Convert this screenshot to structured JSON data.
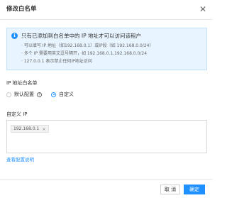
{
  "dialog": {
    "title": "修改白名单",
    "close_icon": "close-icon"
  },
  "notice": {
    "icon": "info-icon",
    "title": "只有已添加到白名单中的 IP 地址才可以访问该租户",
    "lines": [
      "· 可以填写 IP 地址（如192.168.0.1）或IP段（如 192.168.0.0/24）",
      "· 多个 IP 需要用英文逗号隔开，如 192.168.0.1,192.168.0.0/24",
      "· 127.0.0.1 表示禁止任何IP地址访问"
    ]
  },
  "whitelist": {
    "label": "IP 地址白名单",
    "options": [
      {
        "label": "默认配置",
        "selected": false,
        "help_icon": "help-icon"
      },
      {
        "label": "自定义",
        "selected": true
      }
    ]
  },
  "custom_ip": {
    "label": "自定义 IP",
    "tags": [
      "192.168.0.1"
    ],
    "tag_remove": "×"
  },
  "doc_link": "查看配置说明",
  "footer": {
    "cancel_label": "取 消",
    "ok_label": "确定"
  },
  "colors": {
    "accent": "#1e90ff",
    "notice_bg": "#e8f4ff"
  }
}
